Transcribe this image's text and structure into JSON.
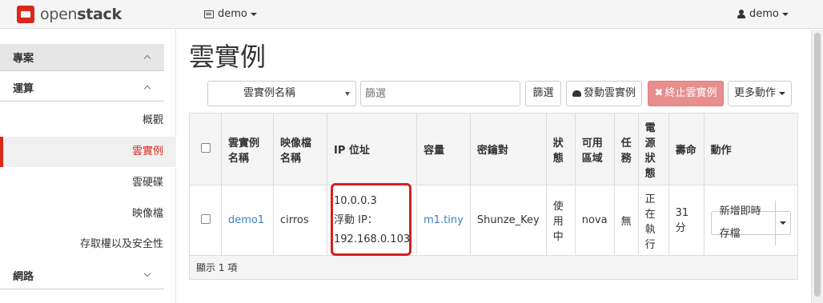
{
  "brand": {
    "name_regular": "open",
    "name_bold": "stack"
  },
  "topbar": {
    "project_label": "demo",
    "user_label": "demo"
  },
  "sidebar": {
    "project_section": "專案",
    "compute_section": "運算",
    "items": [
      {
        "label": "概觀"
      },
      {
        "label": "雲實例"
      },
      {
        "label": "雲硬碟"
      },
      {
        "label": "映像檔"
      },
      {
        "label": "存取權以及安全性"
      }
    ],
    "network_section": "網路"
  },
  "page": {
    "title": "雲實例"
  },
  "toolbar": {
    "filter_field": "雲實例名稱",
    "filter_placeholder": "篩選",
    "filter_button": "篩選",
    "launch_button": "發動雲實例",
    "terminate_button": "終止雲實例",
    "more_button": "更多動作"
  },
  "table": {
    "headers": {
      "name": "雲實例名稱",
      "image": "映像檔名稱",
      "ip": "IP 位址",
      "size": "容量",
      "keypair": "密鑰對",
      "status": "狀態",
      "az": "可用區域",
      "task": "任務",
      "power": "電源狀態",
      "age": "壽命",
      "actions": "動作"
    },
    "rows": [
      {
        "name": "demo1",
        "image": "cirros",
        "ip_fixed": "10.0.0.3",
        "ip_float_label": "浮動 IP：",
        "ip_float": "192.168.0.103",
        "size": "m1.tiny",
        "keypair": "Shunze_Key",
        "status": "使用中",
        "az": "nova",
        "task": "無",
        "power": "正在執行",
        "age": "31 分",
        "action": "新增即時存檔"
      }
    ],
    "footer": "顯示 1 項"
  },
  "colors": {
    "accent": "#d9291c",
    "link": "#3a7fc1",
    "terminate": "#e88e8e"
  }
}
